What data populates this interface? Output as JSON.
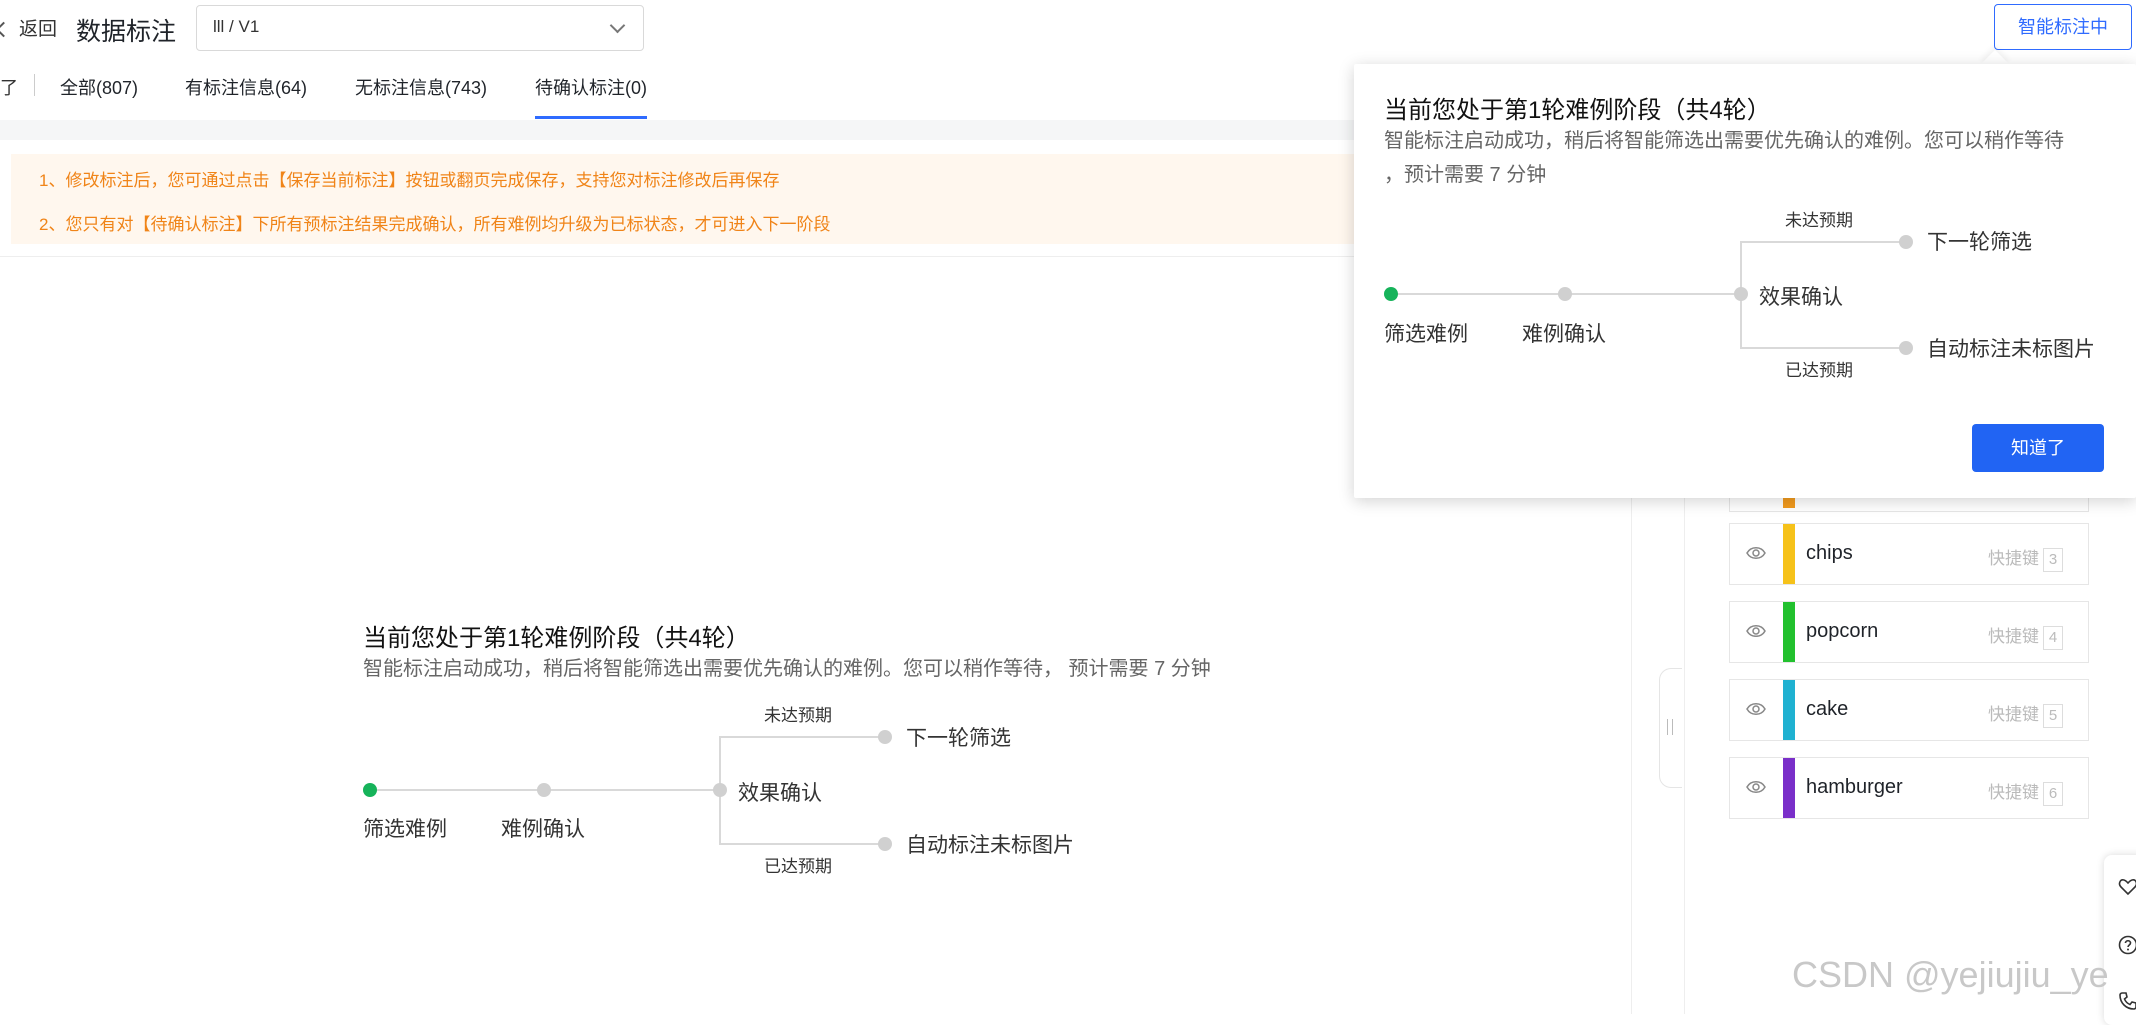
{
  "header": {
    "back_label": "返回",
    "title": "数据标注",
    "dataset_select_value": "lll / V1",
    "status_button": "智能标注中"
  },
  "tabs": {
    "partial": "了",
    "items": [
      "全部(807)",
      "有标注信息(64)",
      "无标注信息(743)",
      "待确认标注(0)"
    ]
  },
  "notice": {
    "line1": "1、修改标注后，您可通过点击【保存当前标注】按钮或翻页完成保存，支持您对标注修改后再保存",
    "line2": "2、您只有对【待确认标注】下所有预标注结果完成确认，所有难例均升级为已标状态，才可进入下一阶段"
  },
  "flow": {
    "title": "当前您处于第1轮难例阶段（共4轮）",
    "desc_main": "智能标注启动成功，稍后将智能筛选出需要优先确认的难例。您可以稍作等待， 预计需要 7 分钟",
    "desc_popover_1": "智能标注启动成功，稍后将智能筛选出需要优先确认的难例。您可以稍作等待",
    "desc_popover_2": "，预计需要 7 分钟",
    "steps": [
      "筛选难例",
      "难例确认",
      "效果确认"
    ],
    "branch_not_met": "未达预期",
    "branch_met": "已达预期",
    "outcome_next": "下一轮筛选",
    "outcome_auto": "自动标注未标图片"
  },
  "popover": {
    "ok_button": "知道了"
  },
  "labels": [
    {
      "name": "chips",
      "color": "#f6c21a",
      "shortcut_label": "快捷键",
      "key": "3"
    },
    {
      "name": "popcorn",
      "color": "#22c12e",
      "shortcut_label": "快捷键",
      "key": "4"
    },
    {
      "name": "cake",
      "color": "#1fb1d1",
      "shortcut_label": "快捷键",
      "key": "5"
    },
    {
      "name": "hamburger",
      "color": "#7a2fc9",
      "shortcut_label": "快捷键",
      "key": "6"
    }
  ],
  "watermark": "CSDN @yejiujiu_ye"
}
